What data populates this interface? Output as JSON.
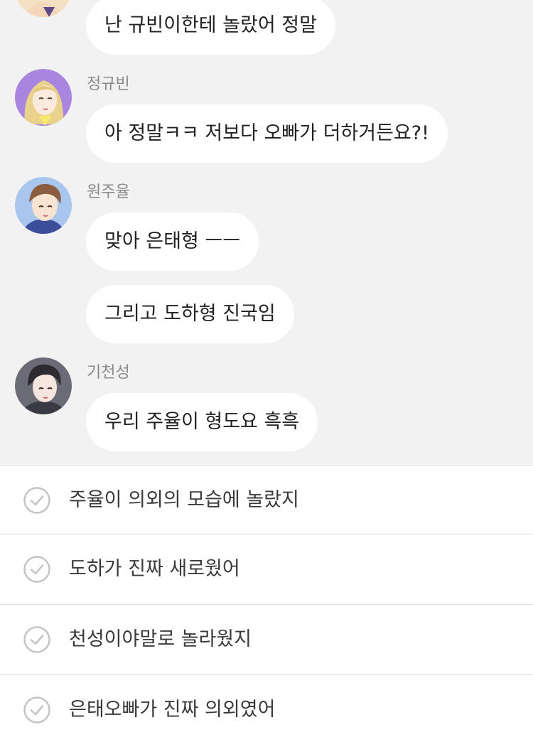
{
  "chat": {
    "messages": [
      {
        "text": "난 규빈이한테 놀랐어 정말"
      },
      {
        "sender": "정규빈",
        "avatar": "girl-blonde-avatar",
        "text": "아 정말ㅋㅋ 저보다 오빠가 더하거든요?!"
      },
      {
        "sender": "원주율",
        "avatar": "boy-brown-hair-avatar",
        "text": "맞아 은태형 ㅡㅡ"
      },
      {
        "text": "그리고 도하형 진국임"
      },
      {
        "sender": "기천성",
        "avatar": "boy-dark-hair-avatar",
        "text": "우리 주율이 형도요 흑흑"
      }
    ]
  },
  "choices": [
    {
      "label": "주율이 의외의 모습에 놀랐지",
      "icon": "check-circle-icon"
    },
    {
      "label": "도하가 진짜 새로웠어",
      "icon": "check-circle-icon"
    },
    {
      "label": "천성이야말로 놀라웠지",
      "icon": "check-circle-icon"
    },
    {
      "label": "은태오빠가 진짜 의외였어",
      "icon": "check-circle-icon"
    }
  ],
  "colors": {
    "chat_background": "#f2f2f2",
    "bubble": "#ffffff",
    "sender_name": "#8a8a8a",
    "divider": "#dcdcdc",
    "check_icon": "#c4c4c4"
  }
}
